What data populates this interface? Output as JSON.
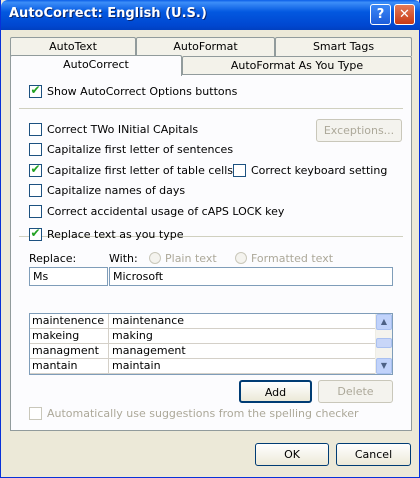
{
  "window": {
    "title": "AutoCorrect: English (U.S.)"
  },
  "titlebar": {
    "help": "?",
    "close": "✕"
  },
  "tabs": {
    "back": [
      "AutoText",
      "AutoFormat",
      "Smart Tags"
    ],
    "front": [
      "AutoCorrect",
      "AutoFormat As You Type"
    ],
    "active": "AutoCorrect"
  },
  "options": {
    "show_buttons": {
      "label": "Show AutoCorrect Options buttons",
      "checked": true
    },
    "two_initials": {
      "label": "Correct TWo INitial CApitals",
      "checked": false
    },
    "first_letter_sentences": {
      "label": "Capitalize first letter of sentences",
      "checked": false
    },
    "first_letter_table": {
      "label": "Capitalize first letter of table cells",
      "checked": true
    },
    "keyboard_setting": {
      "label": "Correct keyboard setting",
      "checked": false
    },
    "names_of_days": {
      "label": "Capitalize names of days",
      "checked": false
    },
    "caps_lock": {
      "label": "Correct accidental usage of cAPS LOCK key",
      "checked": false
    },
    "replace_text": {
      "label": "Replace text as you type",
      "checked": true
    }
  },
  "exceptions_button": "Exceptions...",
  "replace": {
    "replace_label": "Replace:",
    "with_label": "With:",
    "plain_text": "Plain text",
    "formatted_text": "Formatted text",
    "replace_value": "Ms",
    "with_value": "Microsoft"
  },
  "list": {
    "rows": [
      {
        "from": "maintenence",
        "to": "maintenance"
      },
      {
        "from": "makeing",
        "to": "making"
      },
      {
        "from": "managment",
        "to": "management"
      },
      {
        "from": "mantain",
        "to": "maintain"
      }
    ]
  },
  "buttons": {
    "add": "Add",
    "delete": "Delete",
    "ok": "OK",
    "cancel": "Cancel"
  },
  "suggestions": {
    "label": "Automatically use suggestions from the spelling checker",
    "checked": false
  }
}
